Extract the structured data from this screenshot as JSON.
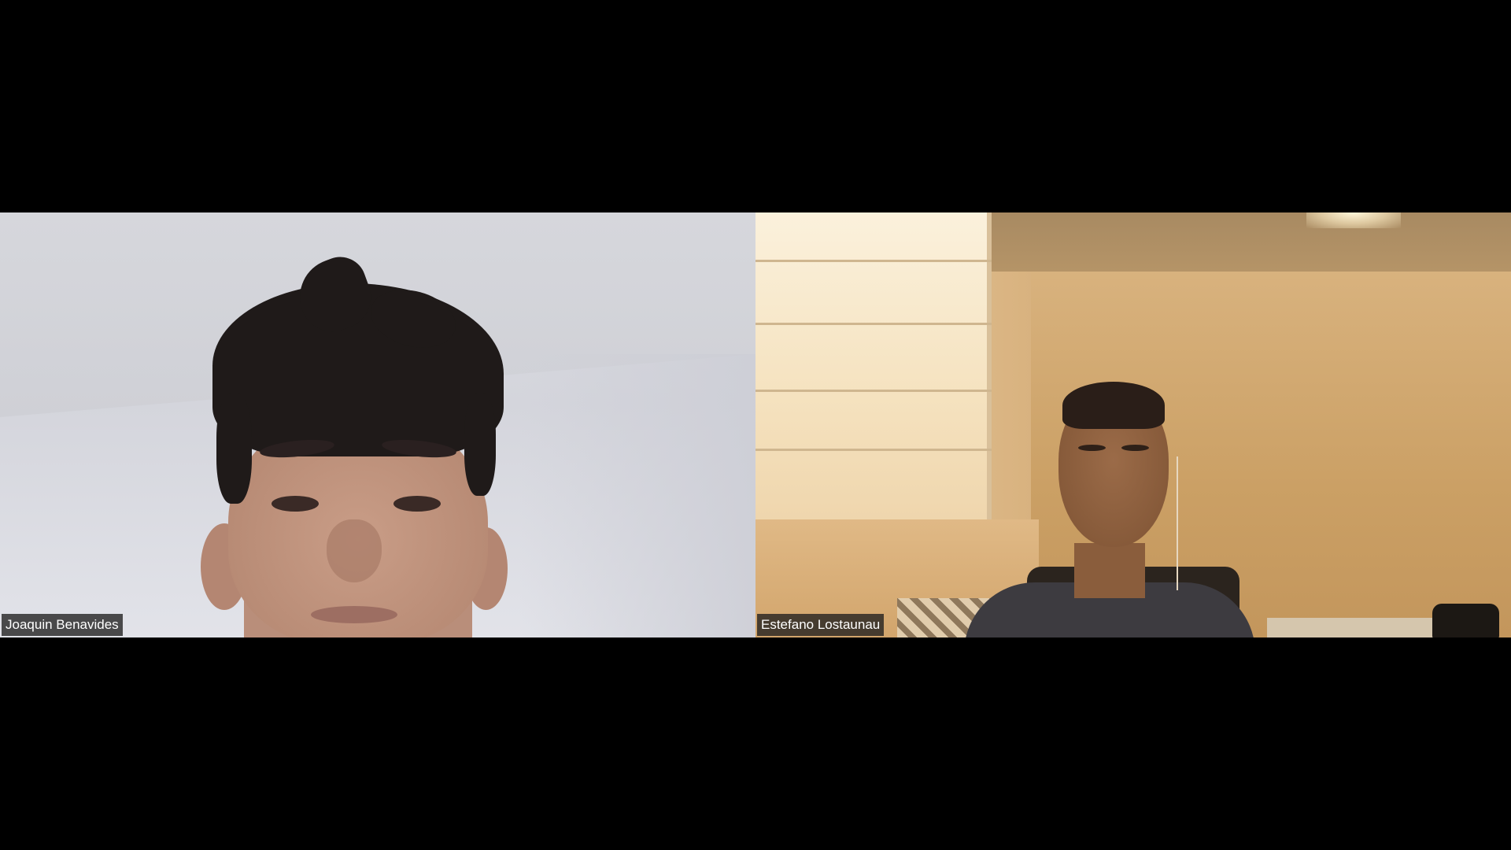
{
  "meeting": {
    "participants": [
      {
        "name": "Joaquin Benavides"
      },
      {
        "name": "Estefano Lostaunau"
      }
    ]
  }
}
